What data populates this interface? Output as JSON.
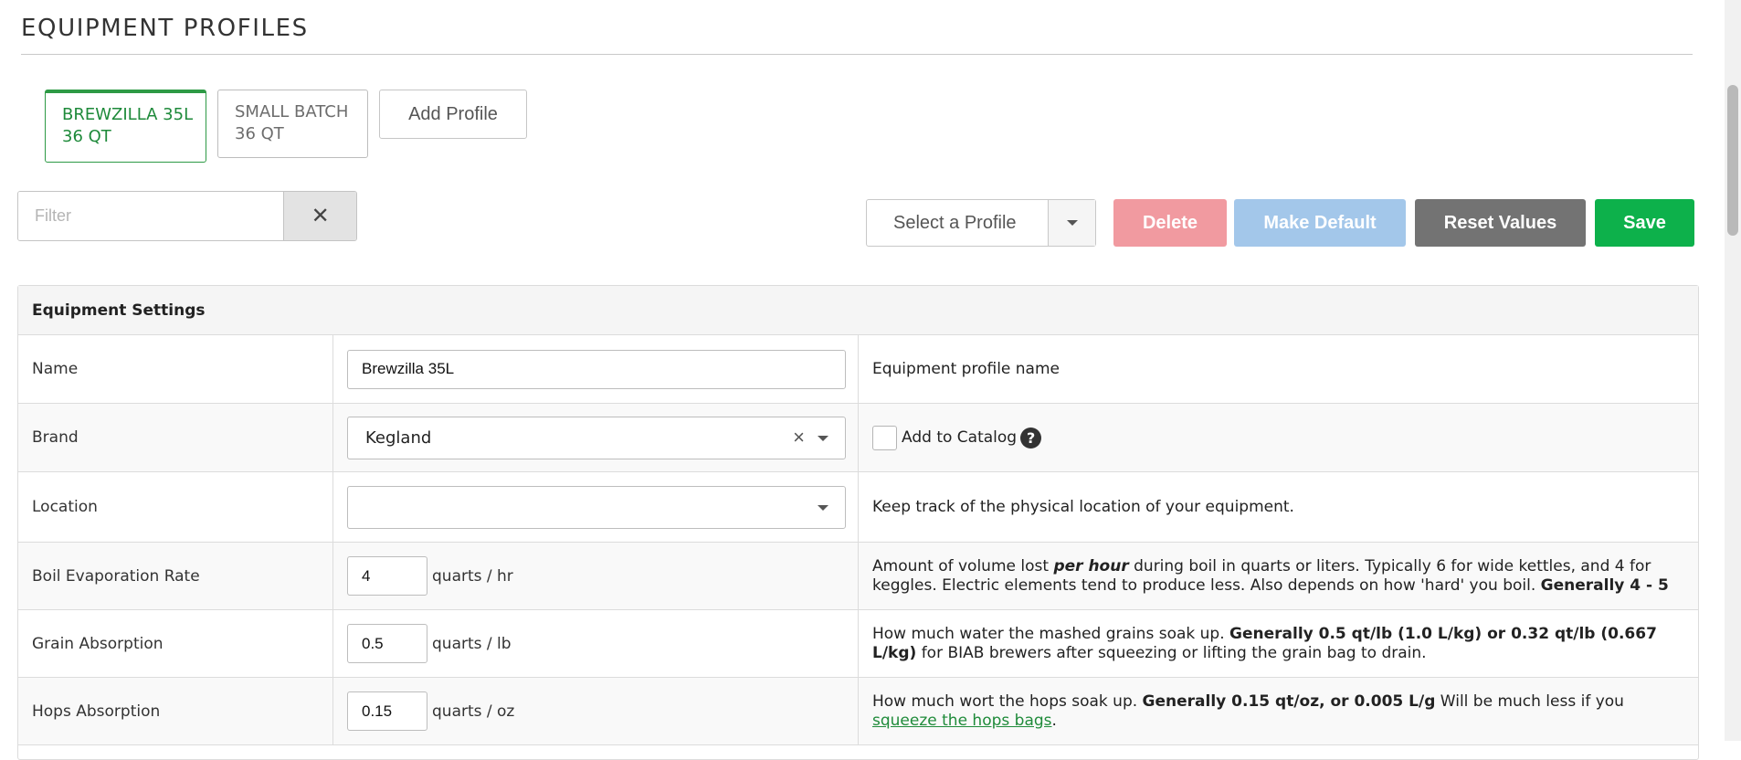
{
  "page": {
    "title": "EQUIPMENT PROFILES"
  },
  "profile_tabs": [
    {
      "line1": "BREWZILLA 35L",
      "line2": "36 QT",
      "active": true
    },
    {
      "line1": "SMALL BATCH",
      "line2": "36 QT",
      "active": false
    }
  ],
  "add_profile_label": "Add Profile",
  "filter": {
    "placeholder": "Filter",
    "clear_symbol": "✕"
  },
  "toolbar": {
    "select_profile": "Select a Profile",
    "delete_label": "Delete",
    "make_default_label": "Make Default",
    "reset_label": "Reset Values",
    "save_label": "Save"
  },
  "colors": {
    "accent_green": "#1e8a3a",
    "delete_disabled": "#f19aa0",
    "make_default_disabled": "#a3c7ea",
    "reset": "#737373",
    "save": "#0db14b"
  },
  "settings": {
    "header": "Equipment Settings",
    "name": {
      "label": "Name",
      "value": "Brewzilla 35L",
      "description": "Equipment profile name"
    },
    "brand": {
      "label": "Brand",
      "value": "Kegland",
      "clear_symbol": "×",
      "catalog_label": "Add to Catalog",
      "help_symbol": "?",
      "add_to_catalog": false
    },
    "location": {
      "label": "Location",
      "value": "",
      "description": "Keep track of the physical location of your equipment."
    },
    "boil_evaporation": {
      "label": "Boil Evaporation Rate",
      "value": "4",
      "unit": "quarts / hr",
      "desc_1": "Amount of volume lost ",
      "desc_em": "per hour",
      "desc_2": " during boil in quarts or liters. Typically 6 for wide kettles, and 4 for keggles. Electric elements tend to produce less. Also depends on how 'hard' you boil. ",
      "desc_strong": "Generally 4 - 5"
    },
    "grain_absorption": {
      "label": "Grain Absorption",
      "value": "0.5",
      "unit": "quarts / lb",
      "desc_1": "How much water the mashed grains soak up. ",
      "desc_strong": "Generally 0.5 qt/lb (1.0 L/kg) or 0.32 qt/lb (0.667 L/kg)",
      "desc_2": " for BIAB brewers after squeezing or lifting the grain bag to drain."
    },
    "hops_absorption": {
      "label": "Hops Absorption",
      "value": "0.15",
      "unit": "quarts / oz",
      "desc_1": "How much wort the hops soak up. ",
      "desc_strong": "Generally 0.15 qt/oz, or 0.005 L/g",
      "desc_2": " Will be much less if you ",
      "desc_link": "squeeze the hops bags",
      "desc_3": "."
    }
  }
}
